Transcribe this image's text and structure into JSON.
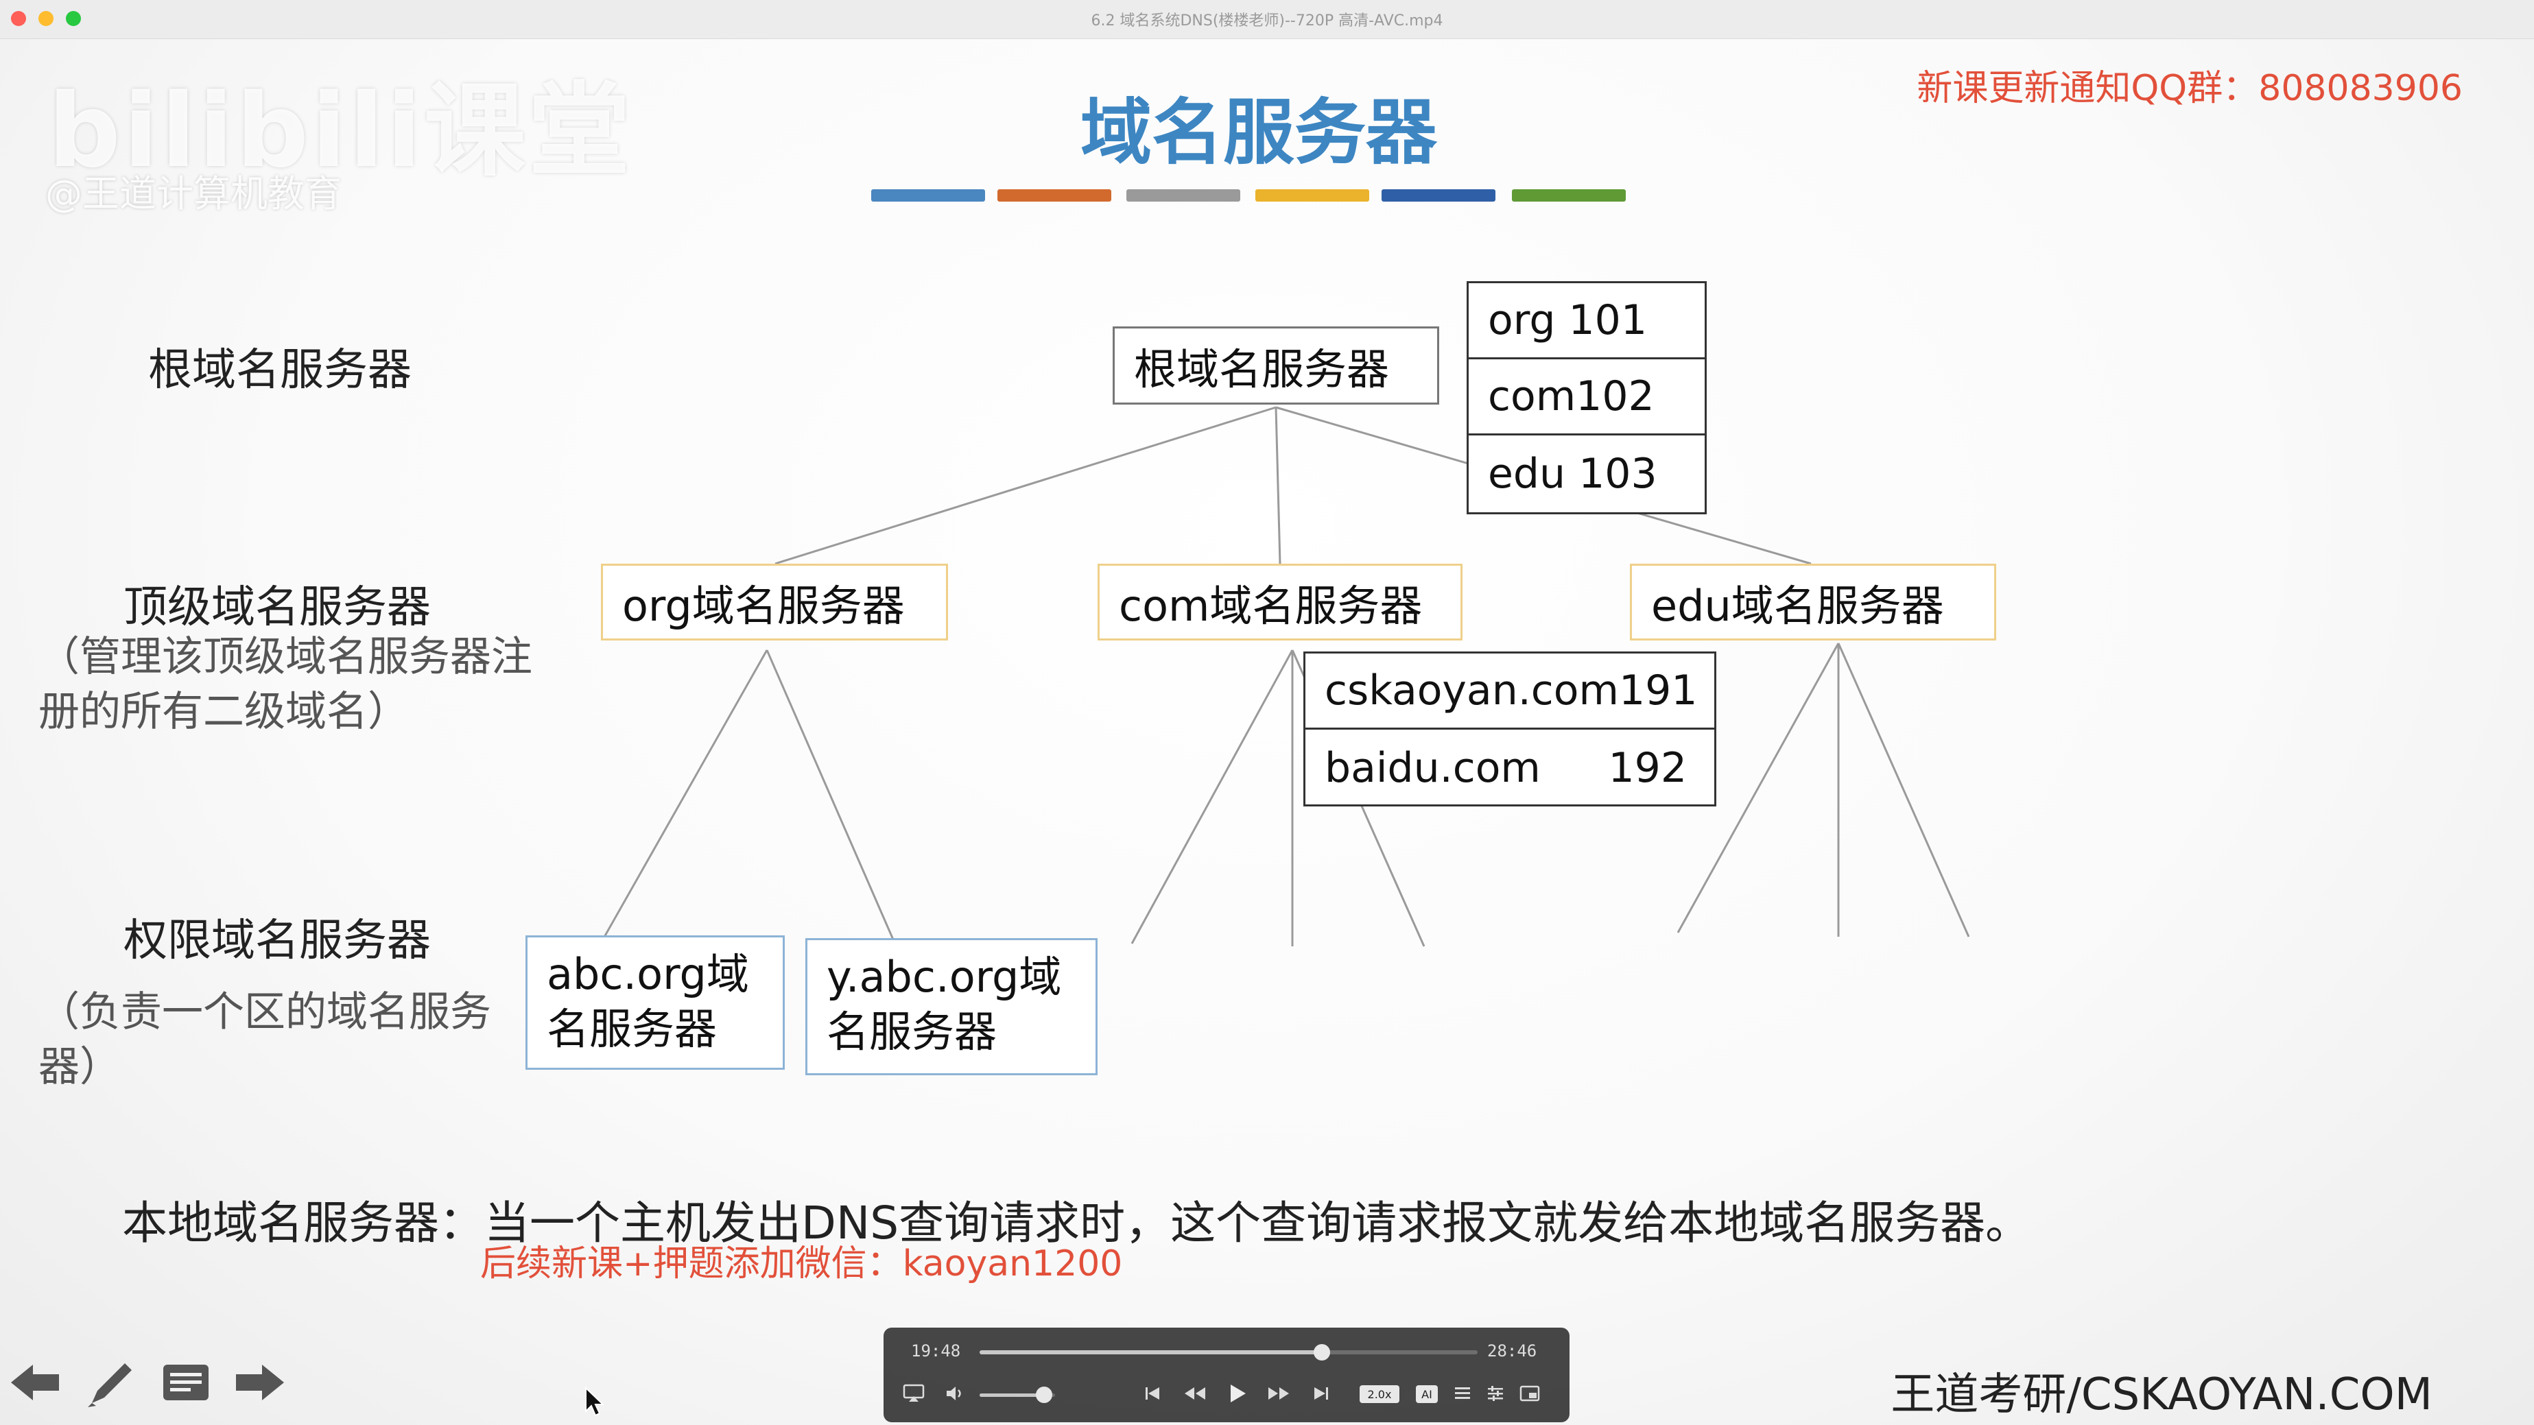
{
  "window": {
    "title": "6.2 域名系统DNS(楼楼老师)--720P 高清-AVC.mp4",
    "traffic_colors": [
      "#fe5f57",
      "#febc2e",
      "#28c840"
    ]
  },
  "watermark": {
    "logo": "bilibili课堂",
    "sub": "@王道计算机教育"
  },
  "slide": {
    "title": "域名服务器",
    "color_bar": [
      "#4a86c0",
      "#d26a2e",
      "#9a9a9a",
      "#ebb32c",
      "#2f5fa6",
      "#5f9a35"
    ],
    "notice": "新课更新通知QQ群：808083906",
    "levels": {
      "root": "根域名服务器",
      "tld": "顶级域名服务器",
      "tld_note": "（管理该顶级域名服务器注册的所有二级域名）",
      "auth": "权限域名服务器",
      "auth_note": "（负责一个区的域名服务器）"
    },
    "nodes": {
      "root": "根域名服务器",
      "org": "org域名服务器",
      "com": "com域名服务器",
      "edu": "edu域名服务器",
      "abc": "abc.org域名服务器",
      "yabc": "y.abc.org域名服务器"
    },
    "root_table": [
      {
        "name": "org 101"
      },
      {
        "name": "com102"
      },
      {
        "name": "edu 103"
      }
    ],
    "com_table": [
      {
        "name": "cskaoyan.com",
        "value": "191"
      },
      {
        "name": "baidu.com",
        "value": "192"
      }
    ],
    "local_dns": "本地域名服务器：当一个主机发出DNS查询请求时，这个查询请求报文就发给本地域名服务器。",
    "wechat": "后续新课+押题添加微信：kaoyan1200",
    "brand": "王道考研/CSKAOYAN.COM"
  },
  "player": {
    "current_time": "19:48",
    "total_time": "28:46",
    "progress": 0.688,
    "volume": 0.85,
    "speed": "2.0x",
    "ai_label": "AI"
  }
}
